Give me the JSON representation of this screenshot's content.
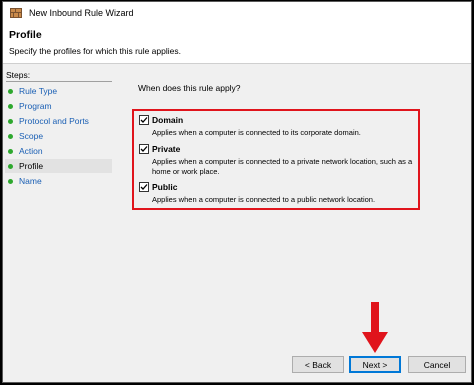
{
  "window": {
    "title": "New Inbound Rule Wizard",
    "icon": "firewall-icon"
  },
  "header": {
    "title": "Profile",
    "subtitle": "Specify the profiles for which this rule applies."
  },
  "sidebar": {
    "steps_label": "Steps:",
    "items": [
      {
        "label": "Rule Type",
        "active": false
      },
      {
        "label": "Program",
        "active": false
      },
      {
        "label": "Protocol and Ports",
        "active": false
      },
      {
        "label": "Scope",
        "active": false
      },
      {
        "label": "Action",
        "active": false
      },
      {
        "label": "Profile",
        "active": true
      },
      {
        "label": "Name",
        "active": false
      }
    ]
  },
  "content": {
    "question": "When does this rule apply?",
    "options": [
      {
        "name": "Domain",
        "checked": true,
        "description": "Applies when a computer is connected to its corporate domain."
      },
      {
        "name": "Private",
        "checked": true,
        "description": "Applies when a computer is connected to a private network location, such as a home or work place."
      },
      {
        "name": "Public",
        "checked": true,
        "description": "Applies when a computer is connected to a public network location."
      }
    ]
  },
  "buttons": {
    "back": "< Back",
    "next": "Next >",
    "cancel": "Cancel"
  },
  "colors": {
    "highlight_border": "#e0141c",
    "annotation_arrow": "#e0141c",
    "step_dot": "#2ea82e",
    "step_link": "#1a5fb4"
  }
}
